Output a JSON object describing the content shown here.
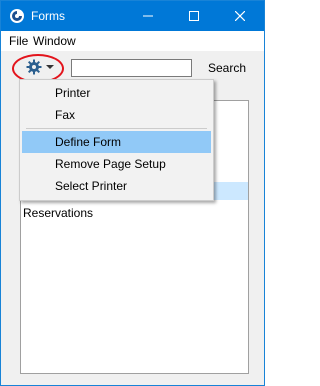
{
  "window": {
    "title": "Forms"
  },
  "menubar": {
    "items": [
      {
        "label": "File"
      },
      {
        "label": "Window"
      }
    ]
  },
  "toolbar": {
    "gear_icon": "gear-icon",
    "search": {
      "value": "",
      "placeholder": ""
    },
    "search_button_label": "Search"
  },
  "list": {
    "items": [
      {
        "label": "",
        "selected": true
      },
      {
        "label": "Reservations",
        "selected": false
      }
    ]
  },
  "popup_menu": {
    "items": [
      {
        "label": "Printer"
      },
      {
        "label": "Fax"
      },
      {
        "label": "Define Form",
        "highlighted": true
      },
      {
        "label": "Remove Page Setup"
      },
      {
        "label": "Select Printer"
      }
    ]
  },
  "colors": {
    "titlebar": "#0078d7",
    "selection": "#cce8ff",
    "menu_highlight": "#91c9f7",
    "annotation_ring": "#e3141c"
  }
}
